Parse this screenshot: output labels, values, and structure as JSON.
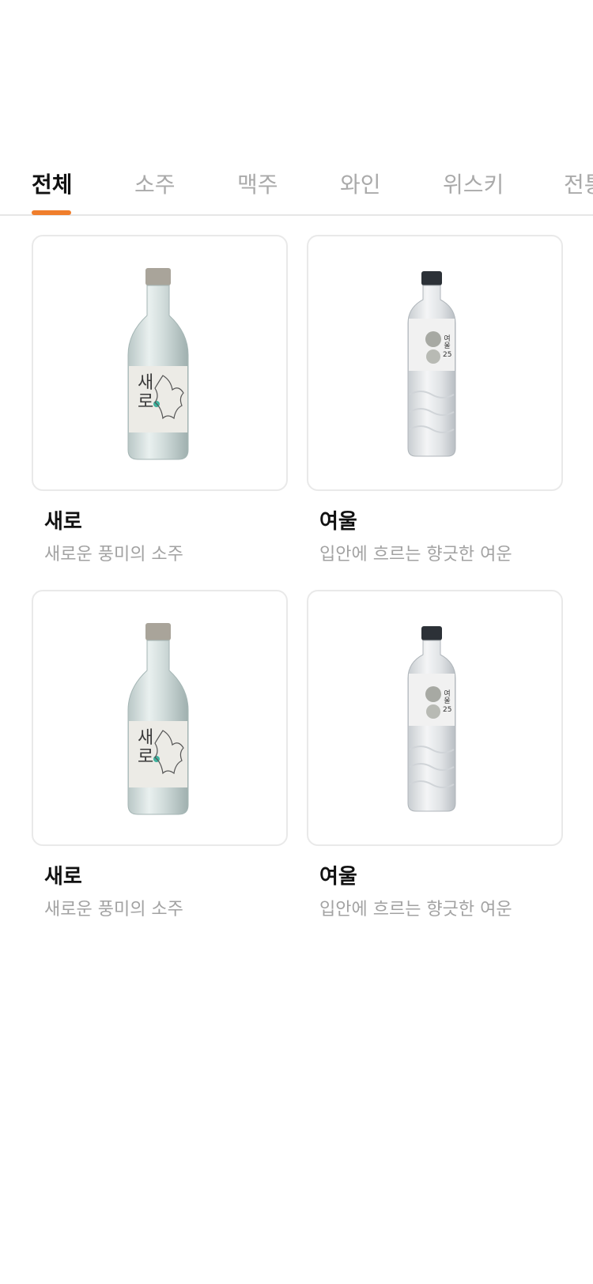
{
  "tabs": [
    {
      "label": "전체",
      "active": true
    },
    {
      "label": "소주",
      "active": false
    },
    {
      "label": "맥주",
      "active": false
    },
    {
      "label": "와인",
      "active": false
    },
    {
      "label": "위스키",
      "active": false
    },
    {
      "label": "전통"
    }
  ],
  "accent_color": "#F07E2C",
  "products": [
    {
      "name": "새로",
      "desc": "새로운 풍미의 소주",
      "image": "saero-bottle",
      "label_text": "새로"
    },
    {
      "name": "여울",
      "desc": "입안에 흐르는 향긋한 여운",
      "image": "yeoul-bottle",
      "label_text": "여울 25"
    },
    {
      "name": "새로",
      "desc": "새로운 풍미의 소주",
      "image": "saero-bottle",
      "label_text": "새로"
    },
    {
      "name": "여울",
      "desc": "입안에 흐르는 향긋한 여운",
      "image": "yeoul-bottle",
      "label_text": "여울 25"
    }
  ]
}
